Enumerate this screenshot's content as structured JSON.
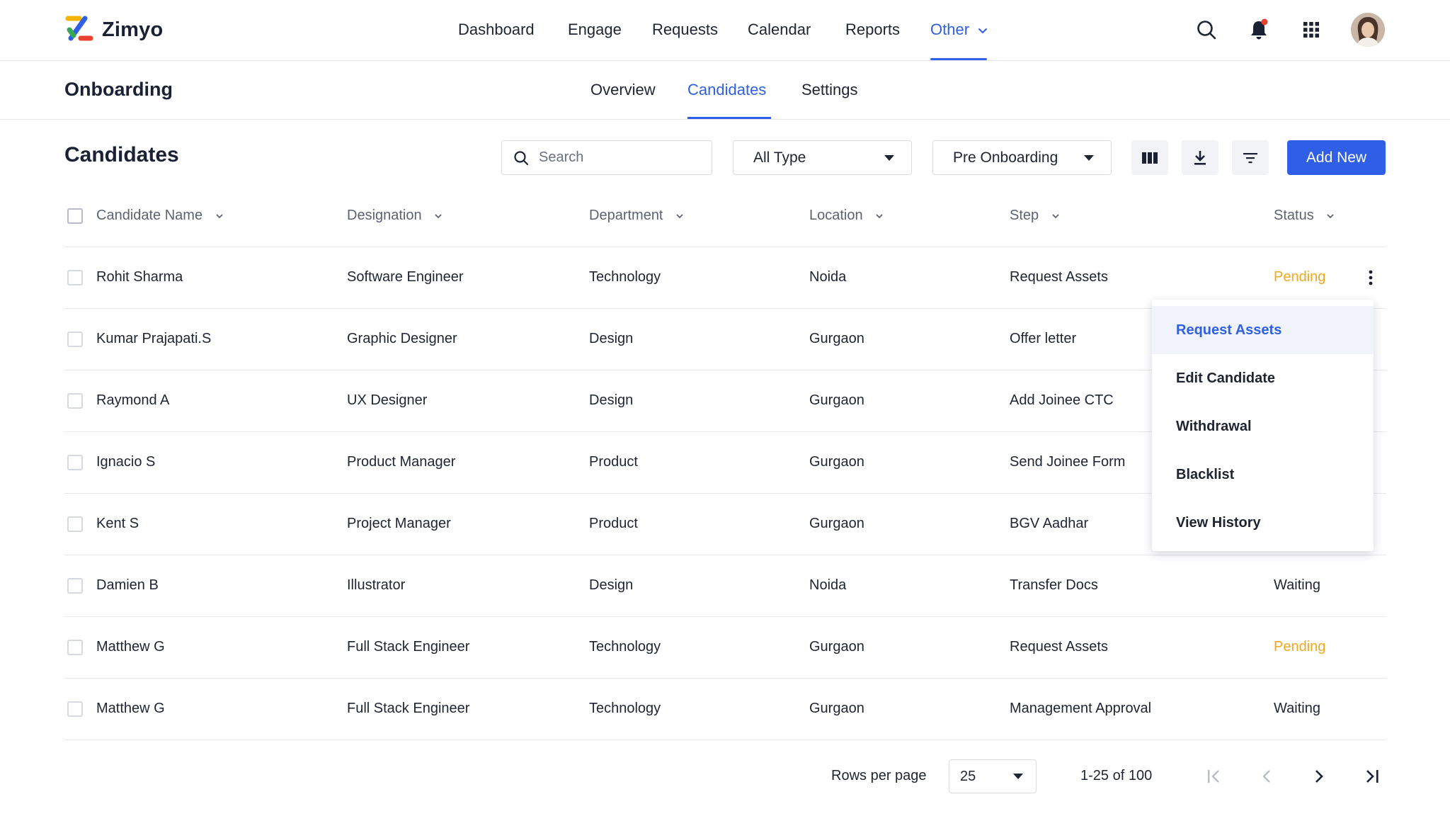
{
  "brand": {
    "name": "Zimyo"
  },
  "nav": {
    "items": [
      "Dashboard",
      "Engage",
      "Requests",
      "Calendar",
      "Reports"
    ],
    "other_label": "Other",
    "active": "Other"
  },
  "header_icons": [
    "search-icon",
    "bell-icon",
    "apps-grid-icon",
    "avatar"
  ],
  "subheader": {
    "title": "Onboarding",
    "tabs": [
      "Overview",
      "Candidates",
      "Settings"
    ],
    "active_tab": "Candidates"
  },
  "toolbar": {
    "title": "Candidates",
    "search_placeholder": "Search",
    "type_filter": "All Type",
    "stage_filter": "Pre Onboarding",
    "add_label": "Add New"
  },
  "table": {
    "columns": [
      "Candidate Name",
      "Designation",
      "Department",
      "Location",
      "Step",
      "Status"
    ],
    "rows": [
      {
        "name": "Rohit Sharma",
        "designation": "Software Engineer",
        "department": "Technology",
        "location": "Noida",
        "step": "Request Assets",
        "status": "Pending"
      },
      {
        "name": "Kumar Prajapati.S",
        "designation": "Graphic Designer",
        "department": "Design",
        "location": "Gurgaon",
        "step": "Offer letter",
        "status": ""
      },
      {
        "name": "Raymond A",
        "designation": "UX Designer",
        "department": "Design",
        "location": "Gurgaon",
        "step": "Add Joinee CTC",
        "status": ""
      },
      {
        "name": "Ignacio S",
        "designation": "Product Manager",
        "department": "Product",
        "location": "Gurgaon",
        "step": "Send Joinee Form",
        "status": ""
      },
      {
        "name": "Kent S",
        "designation": "Project Manager",
        "department": "Product",
        "location": "Gurgaon",
        "step": "BGV Aadhar",
        "status": ""
      },
      {
        "name": "Damien B",
        "designation": "Illustrator",
        "department": "Design",
        "location": "Noida",
        "step": "Transfer Docs",
        "status": "Waiting"
      },
      {
        "name": "Matthew G",
        "designation": "Full Stack Engineer",
        "department": "Technology",
        "location": "Gurgaon",
        "step": "Request Assets",
        "status": "Pending"
      },
      {
        "name": "Matthew G",
        "designation": "Full Stack Engineer",
        "department": "Technology",
        "location": "Gurgaon",
        "step": "Management Approval",
        "status": "Waiting"
      }
    ]
  },
  "row_menu": {
    "items": [
      "Request Assets",
      "Edit Candidate",
      "Withdrawal",
      "Blacklist",
      "View History"
    ],
    "highlighted": "Request Assets"
  },
  "pagination": {
    "rows_per_page_label": "Rows per page",
    "rows_per_page": "25",
    "range": "1-25 of 100"
  },
  "colors": {
    "accent": "#2f5fe6",
    "pending": "#f0a81e",
    "text": "#1f2433",
    "muted": "#5d6272",
    "border": "#e6e8ec"
  }
}
